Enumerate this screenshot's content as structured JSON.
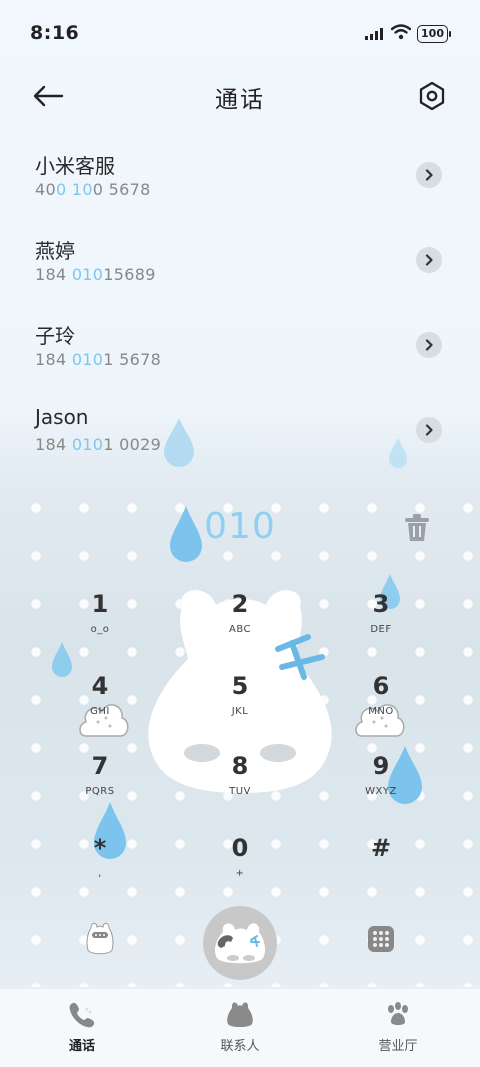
{
  "status_bar": {
    "time": "8:16",
    "battery": "100",
    "icons": [
      "signal-icon",
      "wifi-icon",
      "battery-icon"
    ]
  },
  "header": {
    "title": "通话",
    "back_icon": "back-arrow-icon",
    "settings_icon": "settings-hexagon-icon"
  },
  "contacts": [
    {
      "name": "小米客服",
      "number_parts": [
        "40",
        "0 10",
        "0 5678"
      ]
    },
    {
      "name": "燕婷",
      "number_parts": [
        "184 ",
        "010",
        "15689"
      ]
    },
    {
      "name": "子玲",
      "number_parts": [
        "184 ",
        "010",
        "1 5678"
      ]
    },
    {
      "name": "Jason",
      "number_parts": [
        "184 ",
        "010",
        "1 0029"
      ]
    }
  ],
  "dialer": {
    "typed_number": "010",
    "keys": [
      {
        "digit": "1",
        "letters": "o_o"
      },
      {
        "digit": "2",
        "letters": "ABC"
      },
      {
        "digit": "3",
        "letters": "DEF"
      },
      {
        "digit": "4",
        "letters": "GHI"
      },
      {
        "digit": "5",
        "letters": "JKL"
      },
      {
        "digit": "6",
        "letters": "MNO"
      },
      {
        "digit": "7",
        "letters": "PQRS"
      },
      {
        "digit": "8",
        "letters": "TUV"
      },
      {
        "digit": "9",
        "letters": "WXYZ"
      },
      {
        "digit": "*",
        "letters": ","
      },
      {
        "digit": "0",
        "letters": "+"
      },
      {
        "digit": "#",
        "letters": ""
      }
    ]
  },
  "bottom_nav": [
    {
      "label": "通话",
      "icon": "phone-icon",
      "active": true
    },
    {
      "label": "联系人",
      "icon": "bunny-contacts-icon",
      "active": false
    },
    {
      "label": "营业厅",
      "icon": "paw-icon",
      "active": false
    }
  ],
  "colors": {
    "accent": "#8fd0f0",
    "highlight": "#7ec6ec",
    "text": "#2a2a2a",
    "subtext": "#888888"
  }
}
